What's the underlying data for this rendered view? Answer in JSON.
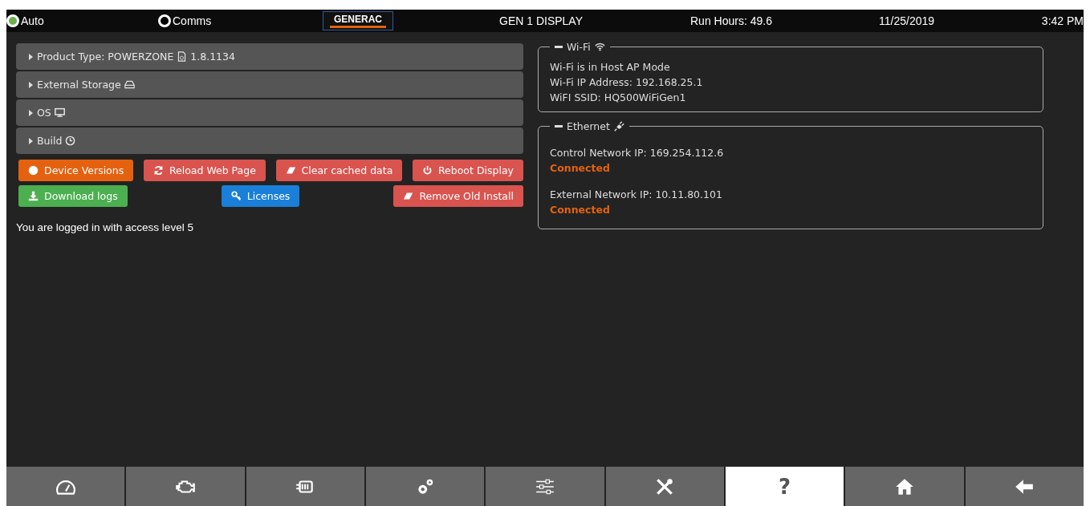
{
  "status_bar": {
    "mode": {
      "label": "Auto",
      "on": true
    },
    "comms": {
      "label": "Comms",
      "on": false
    },
    "logo": "GENERAC",
    "title": "GEN 1 DISPLAY",
    "run_hours": "Run Hours: 49.6",
    "date": "11/25/2019",
    "time": "3:42 PM"
  },
  "sections": [
    {
      "label": "Product Type: POWERZONE",
      "extra": "1.8.1134",
      "expanded": false
    },
    {
      "label": "External Storage",
      "expanded": false
    },
    {
      "label": "OS",
      "expanded": false
    },
    {
      "label": "Build",
      "expanded": false
    }
  ],
  "buttons": [
    [
      {
        "label": "Device Versions",
        "color": "#e4620f"
      },
      {
        "label": "Reload Web Page",
        "color": "#d9534f"
      },
      {
        "label": "Clear cached data",
        "color": "#d9534f"
      },
      {
        "label": "Reboot Display",
        "color": "#d9534f"
      }
    ],
    [
      {
        "label": "Download logs",
        "color": "#4caf50"
      },
      {
        "label": "Licenses",
        "color": "#1a7fd8"
      },
      {
        "label": "Remove Old Install",
        "color": "#d9534f"
      }
    ]
  ],
  "access_message": "You are logged in with access level 5",
  "wifi": {
    "title": "Wi-Fi",
    "expanded": true,
    "lines": [
      "Wi-Fi is in Host AP Mode",
      "Wi-Fi IP Address: 192.168.25.1",
      "WiFI SSID: HQ500WiFiGen1"
    ]
  },
  "ethernet": {
    "title": "Ethernet",
    "expanded": true,
    "networks": [
      {
        "label": "Control Network IP: 169.254.112.6",
        "status": "Connected"
      },
      {
        "label": "External Network IP: 10.11.80.101",
        "status": "Connected"
      }
    ]
  },
  "nav": [
    {
      "selected": false
    },
    {
      "selected": false
    },
    {
      "selected": false
    },
    {
      "selected": false
    },
    {
      "selected": false
    },
    {
      "selected": false
    },
    {
      "label": "?",
      "selected": true
    },
    {
      "selected": false
    },
    {
      "selected": false
    }
  ]
}
